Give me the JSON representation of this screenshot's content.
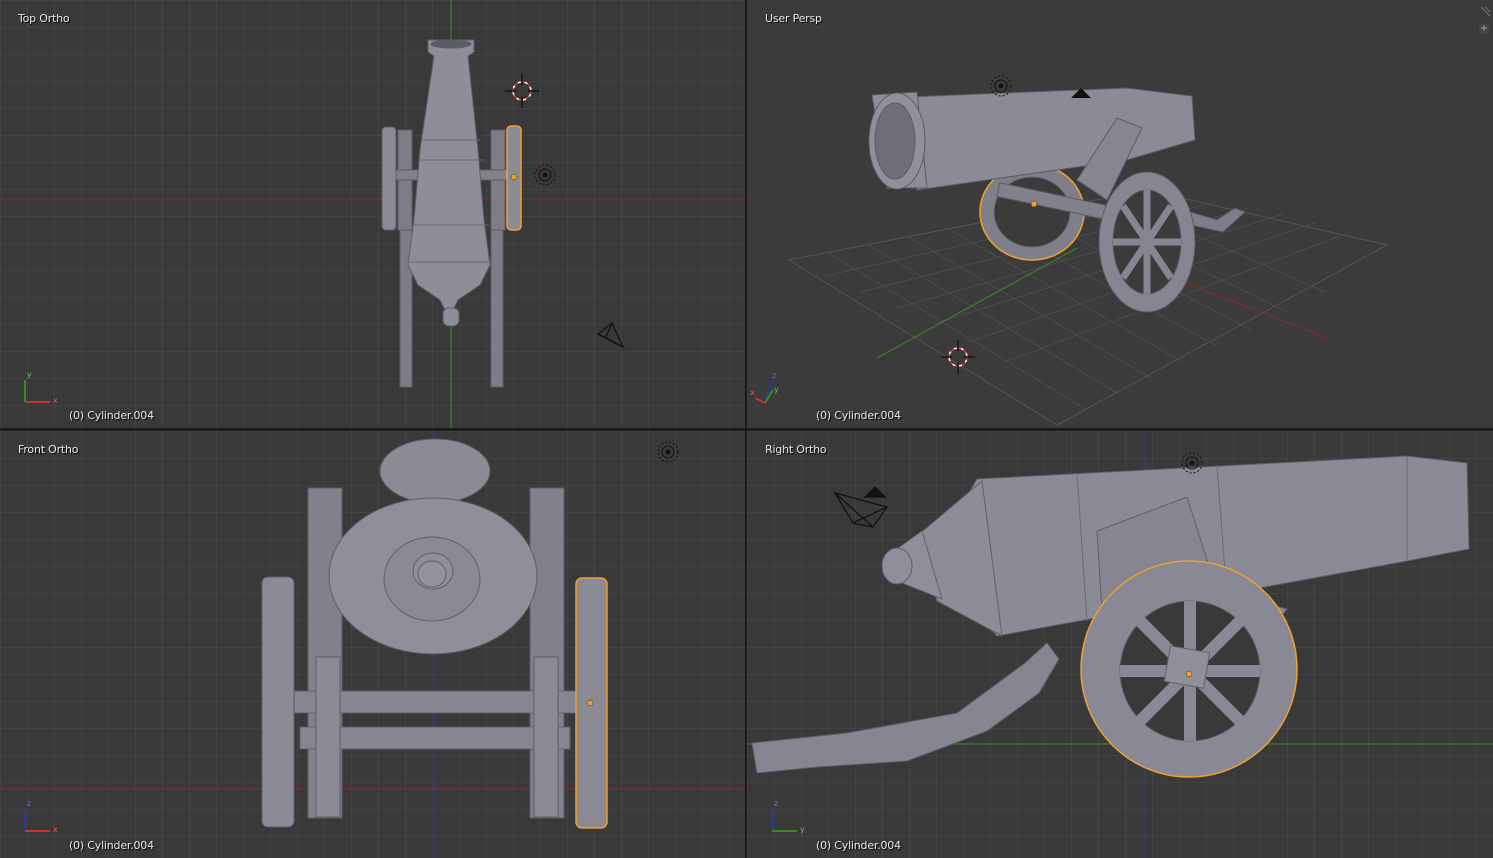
{
  "viewports": {
    "top": {
      "title": "Top Ortho",
      "object_info": "(0) Cylinder.004",
      "axes": [
        "y",
        "x"
      ]
    },
    "persp": {
      "title": "User Persp",
      "object_info": "(0) Cylinder.004",
      "axes": [
        "z",
        "y",
        "x"
      ]
    },
    "front": {
      "title": "Front Ortho",
      "object_info": "(0) Cylinder.004",
      "axes": [
        "z",
        "x"
      ]
    },
    "right": {
      "title": "Right Ortho",
      "object_info": "(0) Cylinder.004",
      "axes": [
        "z",
        "y"
      ]
    }
  },
  "colors": {
    "background": "#393939",
    "grid": "#434343",
    "x_axis": "#8c2a2a",
    "y_axis": "#3a8a2a",
    "z_axis": "#2a3a9a",
    "mesh": "#8a8b95",
    "selection": "#f0a030",
    "text": "#ececec"
  },
  "icons": [
    "3d-cursor-icon",
    "lamp-icon",
    "camera-icon",
    "axis-gizmo-icon",
    "add-region-icon"
  ]
}
